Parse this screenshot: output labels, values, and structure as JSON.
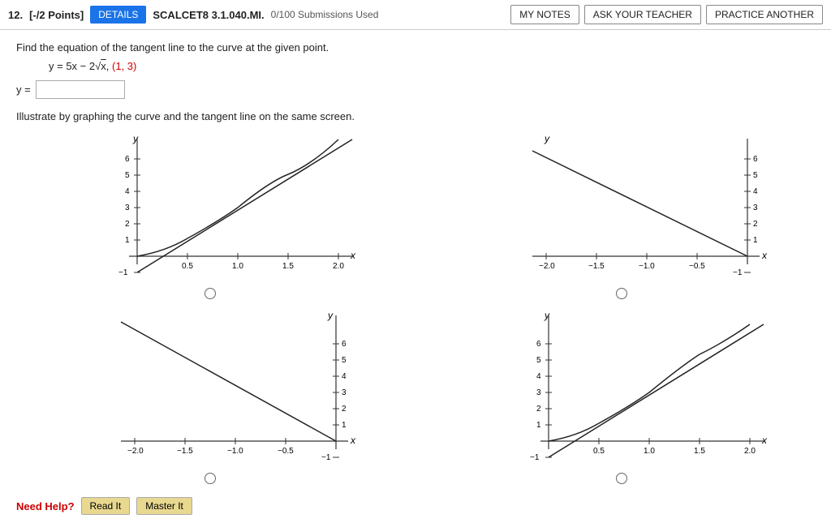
{
  "header": {
    "question_num": "12.",
    "points_label": "[-/2 Points]",
    "details_btn": "DETAILS",
    "scalcet_label": "SCALCET8 3.1.040.MI.",
    "submissions": "0/100 Submissions Used",
    "my_notes_btn": "MY NOTES",
    "ask_teacher_btn": "ASK YOUR TEACHER",
    "practice_btn": "PRACTICE ANOTHER"
  },
  "problem": {
    "instruction": "Find the equation of the tangent line to the curve at the given point.",
    "equation": "y = 5x − 2√x,",
    "point": "(1, 3)",
    "y_label": "y =",
    "illustrate_text": "Illustrate by graphing the curve and the tangent line on the same screen."
  },
  "need_help": {
    "label": "Need Help?",
    "read_it_btn": "Read It",
    "master_it_btn": "Master It"
  }
}
